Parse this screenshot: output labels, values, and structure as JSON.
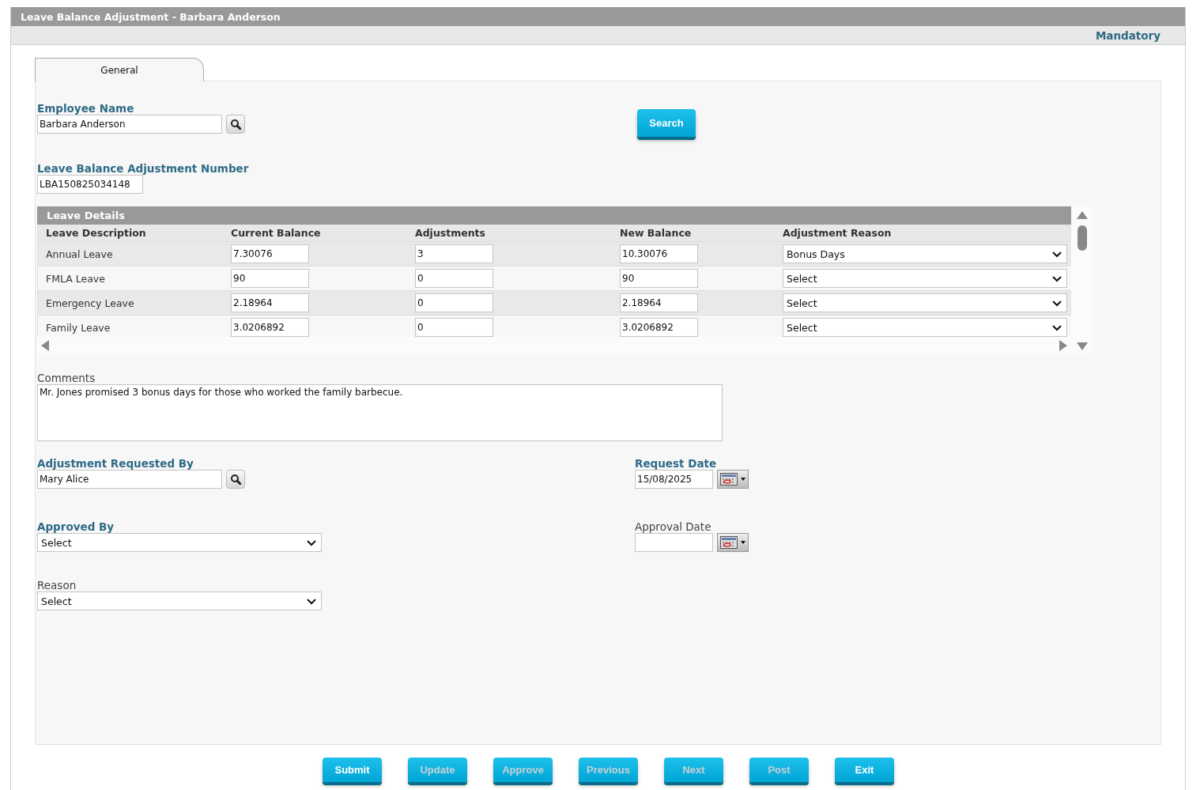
{
  "window": {
    "title": "Leave Balance Adjustment - Barbara Anderson"
  },
  "header": {
    "note": "Mandatory"
  },
  "tabs": [
    {
      "label": "General",
      "selected": true
    }
  ],
  "employee_name": {
    "label": "Employee Name",
    "mandatory": true,
    "value": "Barbara Anderson"
  },
  "search_button": {
    "label": "Search"
  },
  "adjustment_number": {
    "label": "Leave Balance Adjustment Number",
    "mandatory": true,
    "value": "LBA150825034148"
  },
  "leave_details": {
    "title": "Leave Details",
    "columns": [
      "Leave Description",
      "Current Balance",
      "Adjustments",
      "New Balance",
      "Adjustment Reason"
    ],
    "rows": [
      {
        "description": "Annual Leave",
        "current_balance": "7.30076",
        "adjustments": "3",
        "new_balance": "10.30076",
        "reason": "Bonus Days"
      },
      {
        "description": "FMLA Leave",
        "current_balance": "90",
        "adjustments": "0",
        "new_balance": "90",
        "reason": "Select"
      },
      {
        "description": "Emergency Leave",
        "current_balance": "2.18964",
        "adjustments": "0",
        "new_balance": "2.18964",
        "reason": "Select"
      },
      {
        "description": "Family Leave",
        "current_balance": "3.0206892",
        "adjustments": "0",
        "new_balance": "3.0206892",
        "reason": "Select"
      }
    ]
  },
  "comments": {
    "label": "Comments",
    "mandatory": false,
    "value": "Mr. Jones promised 3 bonus days for those who worked the family barbecue."
  },
  "requested_by": {
    "label": "Adjustment Requested By",
    "mandatory": true,
    "value": "Mary Alice"
  },
  "request_date": {
    "label": "Request Date",
    "mandatory": true,
    "value": "15/08/2025"
  },
  "approved_by": {
    "label": "Approved By",
    "mandatory": true,
    "value": "Select"
  },
  "approval_date": {
    "label": "Approval Date",
    "mandatory": false
  },
  "reason": {
    "label": "Reason",
    "mandatory": false,
    "value": "Select"
  },
  "buttons": [
    {
      "label": "Submit",
      "disabled": false
    },
    {
      "label": "Update",
      "disabled": true
    },
    {
      "label": "Approve",
      "disabled": true
    },
    {
      "label": "Previous",
      "disabled": true
    },
    {
      "label": "Next",
      "disabled": true
    },
    {
      "label": "Post",
      "disabled": true
    },
    {
      "label": "Exit",
      "disabled": false
    }
  ]
}
